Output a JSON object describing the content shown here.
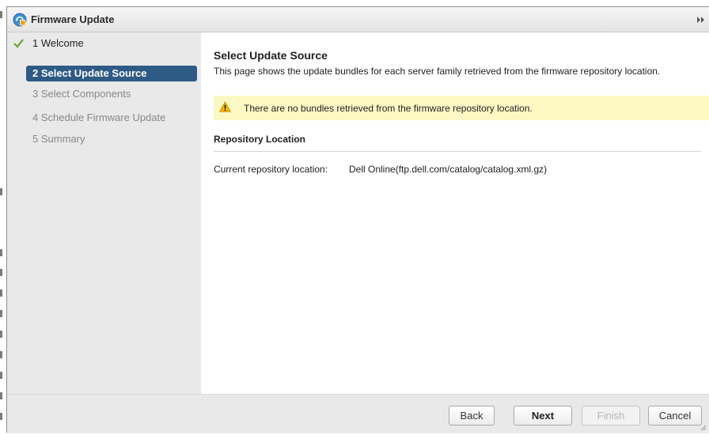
{
  "window": {
    "title": "Firmware Update",
    "title_icon": "firmware-update-icon",
    "expand_icon": "double-chevron-right-icon"
  },
  "steps": [
    {
      "label": "1 Welcome",
      "state": "done"
    },
    {
      "label": "2 Select Update Source",
      "state": "active"
    },
    {
      "label": "3 Select Components",
      "state": "pending"
    },
    {
      "label": "4 Schedule Firmware Update",
      "state": "pending"
    },
    {
      "label": "5 Summary",
      "state": "pending"
    }
  ],
  "content": {
    "title": "Select Update Source",
    "description": "This page shows the update bundles for each server family retrieved from the firmware repository location.",
    "warning": {
      "icon": "warning-icon",
      "text": "There are no bundles retrieved from the firmware repository location."
    },
    "section_title": "Repository Location",
    "repo_label": "Current repository location:",
    "repo_value": "Dell Online(ftp.dell.com/catalog/catalog.xml.gz)"
  },
  "footer": {
    "back": "Back",
    "next": "Next",
    "finish": "Finish",
    "cancel": "Cancel"
  },
  "colors": {
    "active_step_bg": "#2e5a86",
    "sidebar_bg": "#e9e9e9",
    "warning_bg": "#fbf8c4",
    "check_green": "#5ea82b",
    "warning_yellow": "#f1b800"
  }
}
